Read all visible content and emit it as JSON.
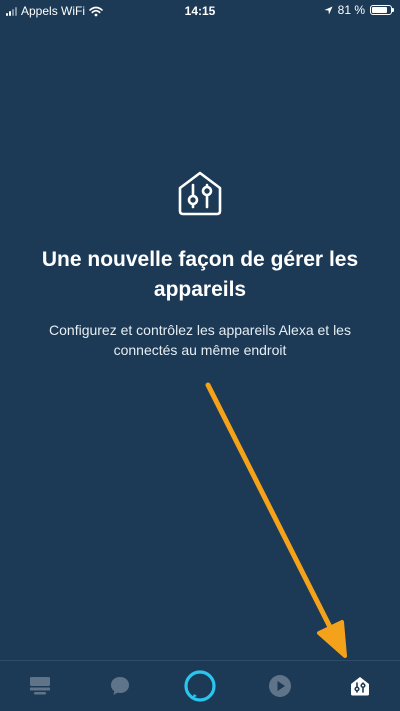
{
  "status_bar": {
    "carrier": "Appels WiFi",
    "time": "14:15",
    "battery": "81 %",
    "battery_level": 0.81
  },
  "hero": {
    "icon": "smart-home-icon",
    "title": "Une nouvelle façon de gérer les appareils",
    "description": "Configurez et contrôlez les appareils Alexa et les connectés au même endroit"
  },
  "tab_bar": {
    "tabs": [
      {
        "icon": "home-dashboard-icon",
        "active": false
      },
      {
        "icon": "chat-bubble-icon",
        "active": false
      },
      {
        "icon": "alexa-ring-icon",
        "active": false
      },
      {
        "icon": "play-icon",
        "active": false
      },
      {
        "icon": "devices-house-icon",
        "active": true
      }
    ]
  },
  "colors": {
    "background": "#1c3a55",
    "accent_arrow": "#f5a21b",
    "alexa_blue": "#2bc6f0",
    "inactive_icon": "#5f7488"
  }
}
